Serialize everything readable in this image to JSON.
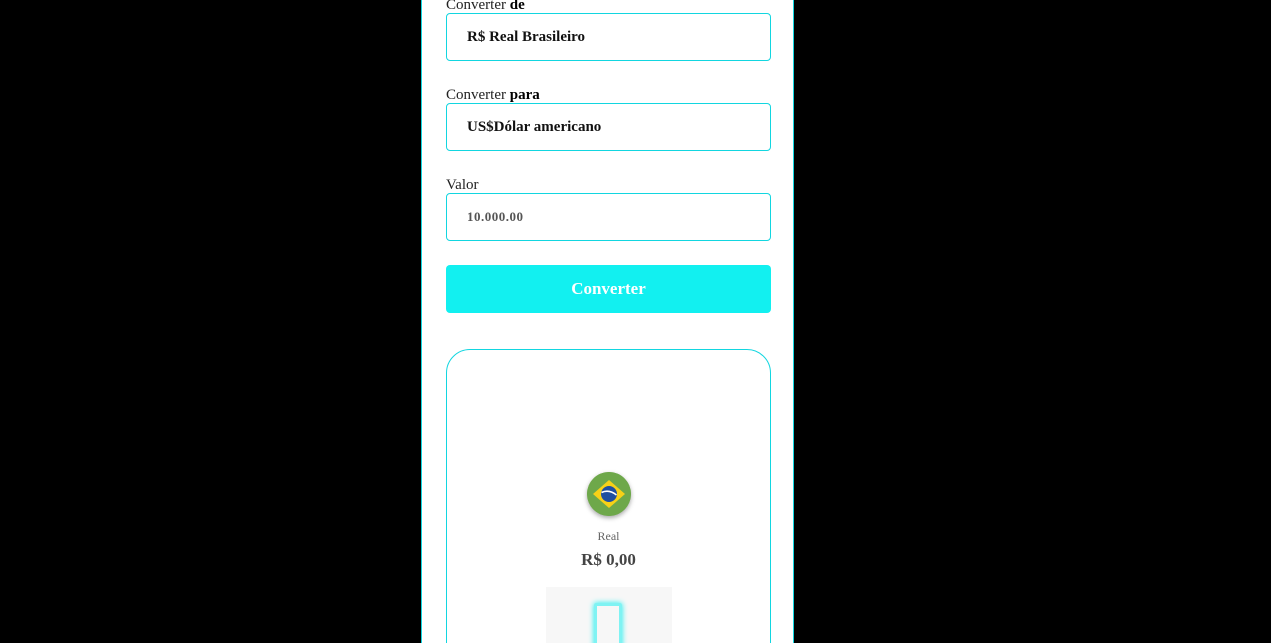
{
  "form": {
    "from_label_prefix": "Converter",
    "from_label_bold": "de",
    "from_value": "R$ Real Brasileiro",
    "to_label_prefix": "Converter",
    "to_label_bold": "para",
    "to_value": "US$Dólar americano",
    "amount_label": "Valor",
    "amount_placeholder": "10.000.00",
    "convert_button": "Converter"
  },
  "result": {
    "flag_icon": "brazil-flag-icon",
    "currency_name": "Real",
    "currency_value": "R$ 0,00",
    "arrow_icon": "arrow-placeholder-icon"
  },
  "colors": {
    "accent": "#12f0f0",
    "border": "#12d6e0",
    "background": "#000000"
  }
}
